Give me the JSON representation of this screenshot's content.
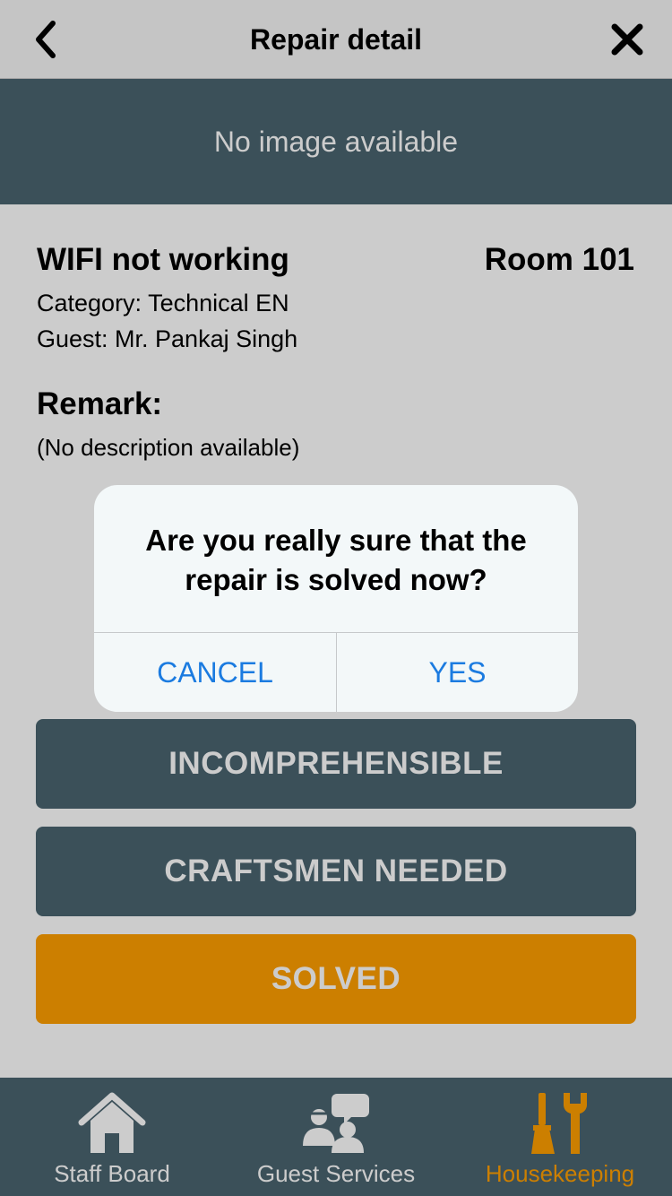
{
  "navbar": {
    "title": "Repair detail",
    "back_icon": "chevron-left-icon",
    "close_icon": "close-x-icon"
  },
  "image_placeholder": "No image available",
  "repair": {
    "title": "WIFI not working",
    "room": "Room 101",
    "category": "Category: Technical EN",
    "guest": "Guest: Mr. Pankaj Singh",
    "remark_label": "Remark:",
    "remark_text": "(No description available)"
  },
  "actions": {
    "incomprehensible": "INCOMPREHENSIBLE",
    "craftsmen_needed": "CRAFTSMEN NEEDED",
    "solved": "SOLVED"
  },
  "alert": {
    "message": "Are you really sure that the repair is solved now?",
    "cancel": "CANCEL",
    "yes": "YES"
  },
  "tabbar": {
    "items": [
      {
        "label": "Staff Board",
        "icon": "house-icon",
        "active": false
      },
      {
        "label": "Guest Services",
        "icon": "people-chat-icon",
        "active": false
      },
      {
        "label": "Housekeeping",
        "icon": "broom-wrench-icon",
        "active": true
      }
    ]
  },
  "colors": {
    "primary_dark": "#4a6470",
    "accent": "#ff9f00",
    "link_blue": "#1b7be0",
    "tab_inactive": "#ffffff"
  }
}
